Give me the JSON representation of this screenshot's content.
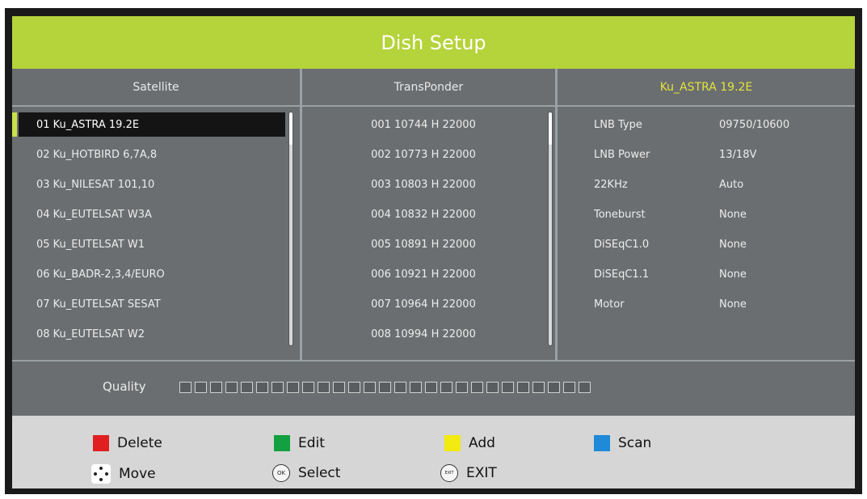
{
  "title": "Dish Setup",
  "columns": {
    "satellite": "Satellite",
    "transponder": "TransPonder",
    "selected_satellite": "Ku_ASTRA 19.2E"
  },
  "satellites": [
    "01 Ku_ASTRA 19.2E",
    "02 Ku_HOTBIRD 6,7A,8",
    "03 Ku_NILESAT 101,10",
    "04 Ku_EUTELSAT W3A",
    "05 Ku_EUTELSAT W1",
    "06 Ku_BADR-2,3,4/EURO",
    "07 Ku_EUTELSAT SESAT",
    "08 Ku_EUTELSAT W2"
  ],
  "selected_index": 0,
  "transponders": [
    "001 10744 H 22000",
    "002 10773 H 22000",
    "003 10803 H 22000",
    "004 10832 H 22000",
    "005 10891 H 22000",
    "006 10921 H 22000",
    "007 10964 H 22000",
    "008 10994 H 22000"
  ],
  "settings": [
    {
      "label": "LNB Type",
      "value": "09750/10600"
    },
    {
      "label": "LNB Power",
      "value": "13/18V"
    },
    {
      "label": "22KHz",
      "value": "Auto"
    },
    {
      "label": "Toneburst",
      "value": "None"
    },
    {
      "label": "DiSEqC1.0",
      "value": "None"
    },
    {
      "label": "DiSEqC1.1",
      "value": "None"
    },
    {
      "label": "Motor",
      "value": "None"
    }
  ],
  "quality": {
    "label": "Quality",
    "level": 0
  },
  "legend": {
    "delete": {
      "label": "Delete",
      "color": "#e02020"
    },
    "edit": {
      "label": "Edit",
      "color": "#13a040"
    },
    "add": {
      "label": "Add",
      "color": "#f2ea10"
    },
    "scan": {
      "label": "Scan",
      "color": "#1e8ad8"
    },
    "move": {
      "label": "Move"
    },
    "select": {
      "label": "Select",
      "icon_text": "OK"
    },
    "exit": {
      "label": "EXIT",
      "icon_text": "EXIT"
    }
  }
}
